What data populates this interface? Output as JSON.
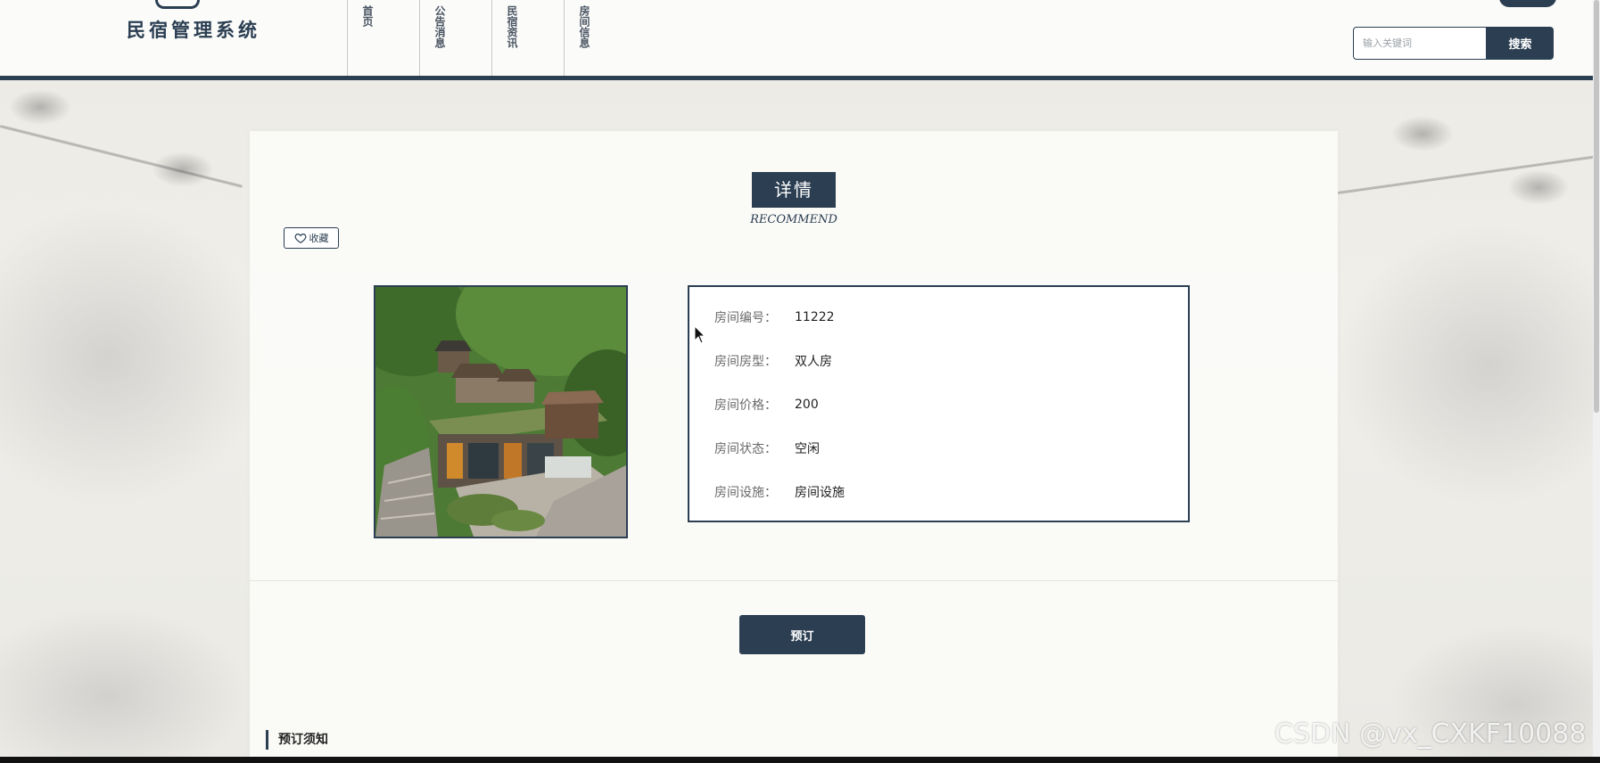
{
  "header": {
    "site_title": "民宿管理系统",
    "nav": [
      {
        "label": "首页"
      },
      {
        "label": "公告消息"
      },
      {
        "label": "民宿资讯"
      },
      {
        "label": "房间信息"
      }
    ],
    "search": {
      "placeholder": "输入关键词",
      "button_label": "搜索"
    }
  },
  "detail": {
    "title": "详情",
    "subtitle": "RECOMMEND",
    "favorite_label": "收藏",
    "fields": [
      {
        "label": "房间编号：",
        "value": "11222"
      },
      {
        "label": "房间房型：",
        "value": "双人房"
      },
      {
        "label": "房间价格：",
        "value": "200"
      },
      {
        "label": "房间状态：",
        "value": "空闲"
      },
      {
        "label": "房间设施：",
        "value": "房间设施"
      }
    ],
    "book_label": "预订",
    "notice_title": "预订须知"
  },
  "watermark": "CSDN @vx_CXKF10088",
  "colors": {
    "primary": "#2b3e52",
    "background": "#eceae4"
  },
  "icons": {
    "favorite": "heart-outline-icon"
  }
}
